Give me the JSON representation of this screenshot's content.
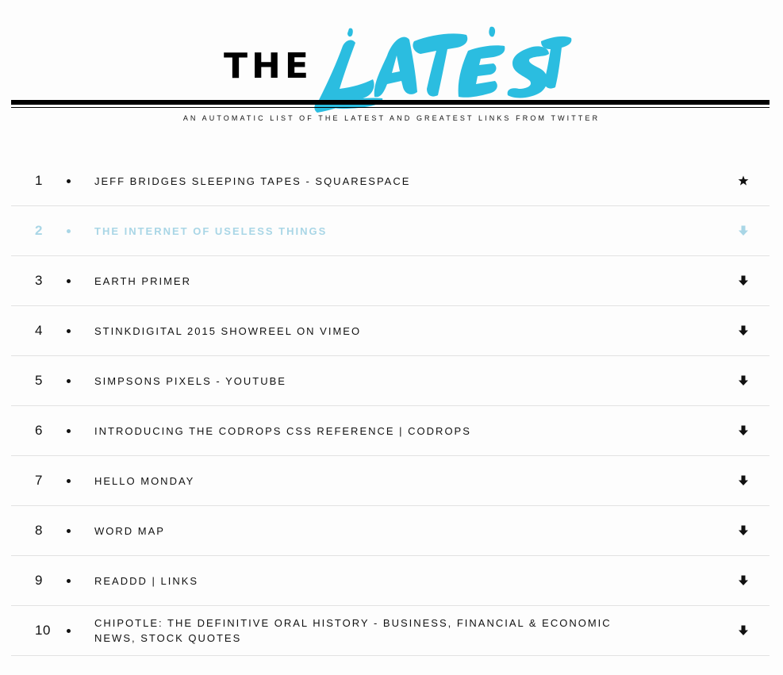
{
  "header": {
    "logo_the": "THE",
    "logo_latest": "LATEST",
    "tagline": "AN AUTOMATIC LIST OF THE LATEST AND GREATEST LINKS FROM TWITTER"
  },
  "colors": {
    "accent": "#2bbde0",
    "dimmed": "#a9d6e6",
    "text": "#111111"
  },
  "items": [
    {
      "number": "1",
      "title": "JEFF BRIDGES SLEEPING TAPES - SQUARESPACE",
      "icon": "star-icon"
    },
    {
      "number": "2",
      "title": "THE INTERNET OF USELESS THINGS",
      "icon": "arrow-down-icon"
    },
    {
      "number": "3",
      "title": "EARTH PRIMER",
      "icon": "arrow-down-icon"
    },
    {
      "number": "4",
      "title": "STINKDIGITAL 2015 SHOWREEL ON VIMEO",
      "icon": "arrow-down-icon"
    },
    {
      "number": "5",
      "title": "SIMPSONS PIXELS - YOUTUBE",
      "icon": "arrow-down-icon"
    },
    {
      "number": "6",
      "title": "INTRODUCING THE CODROPS CSS REFERENCE | CODROPS",
      "icon": "arrow-down-icon"
    },
    {
      "number": "7",
      "title": "HELLO MONDAY",
      "icon": "arrow-down-icon"
    },
    {
      "number": "8",
      "title": "WORD MAP",
      "icon": "arrow-down-icon"
    },
    {
      "number": "9",
      "title": "READDD | LINKS",
      "icon": "arrow-down-icon"
    },
    {
      "number": "10",
      "title": "CHIPOTLE: THE DEFINITIVE ORAL HISTORY - BUSINESS, FINANCIAL & ECONOMIC NEWS, STOCK QUOTES",
      "icon": "arrow-down-icon"
    }
  ]
}
